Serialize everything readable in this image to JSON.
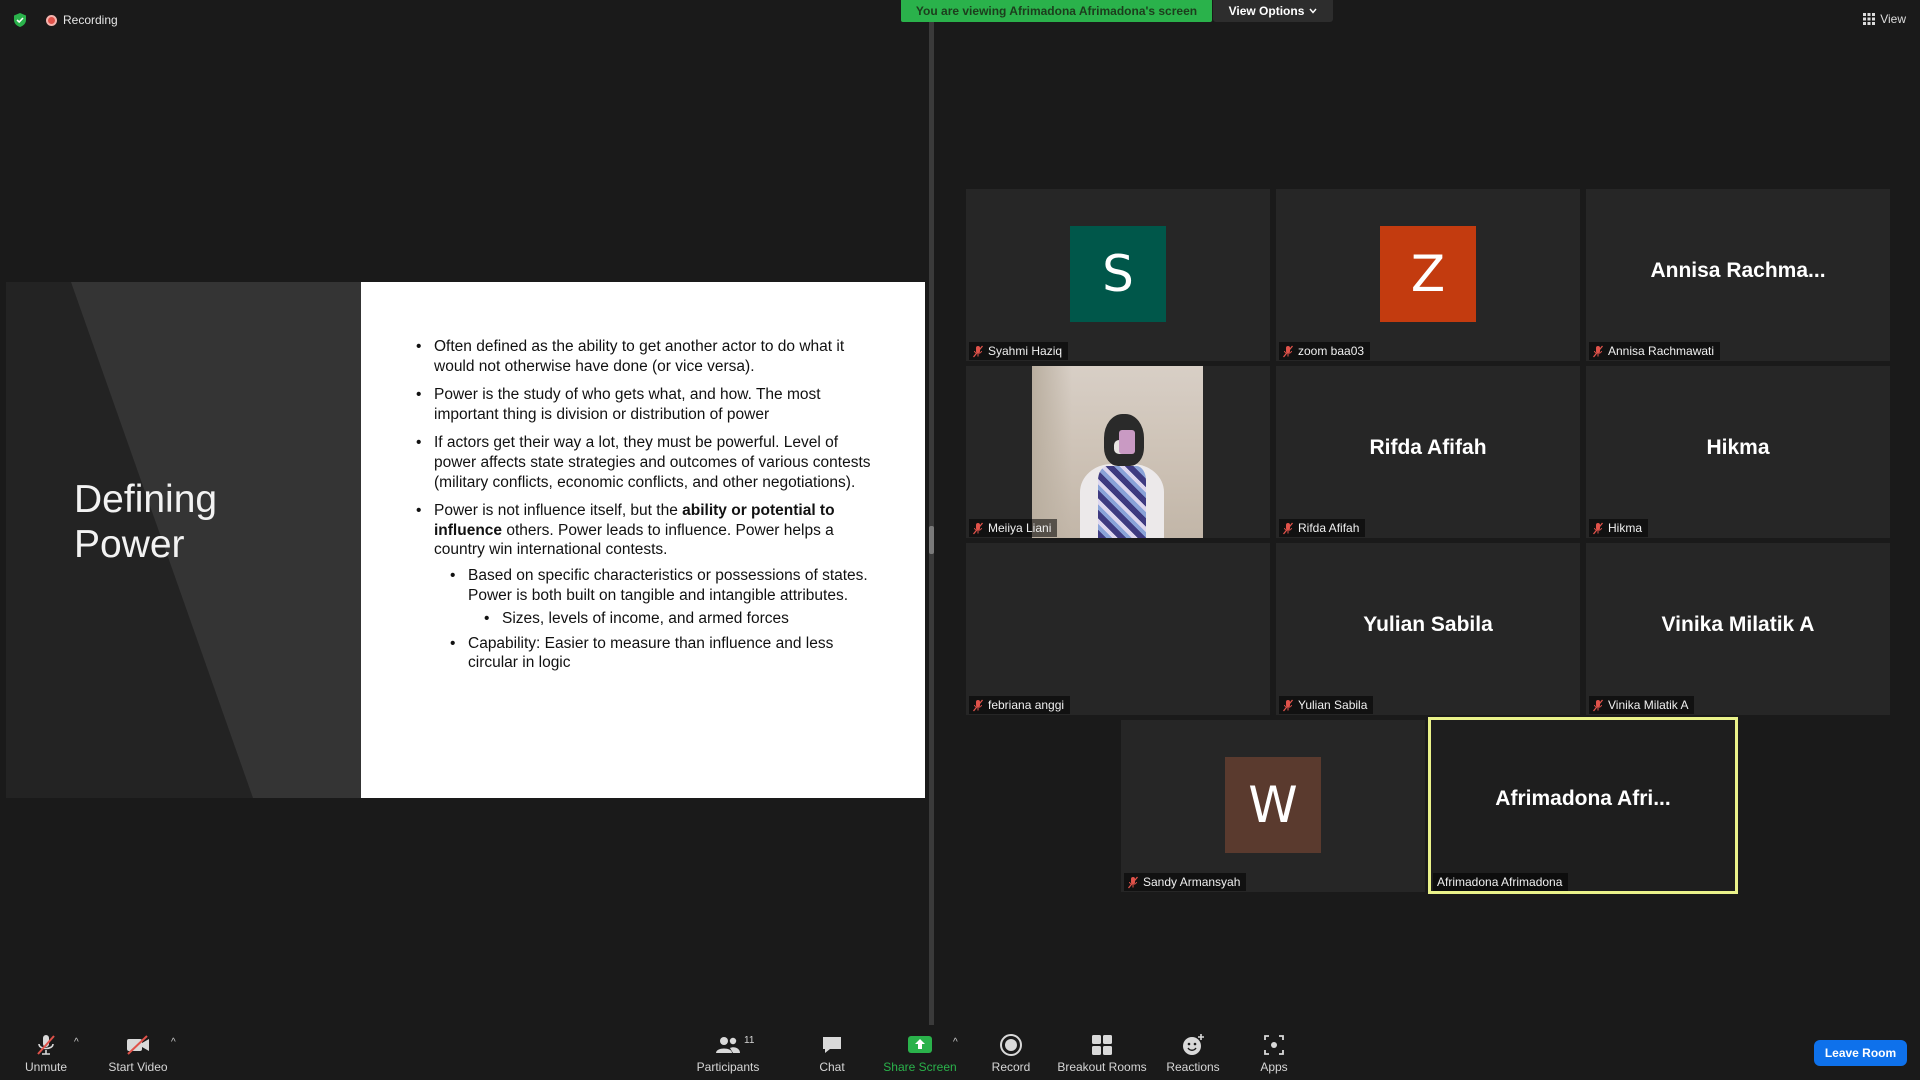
{
  "topbar": {
    "recording_label": "Recording",
    "viewing_banner": "You are viewing Afrimadona Afrimadona's screen",
    "view_options_label": "View Options",
    "view_label": "View"
  },
  "slide": {
    "title_line1": "Defining",
    "title_line2": "Power",
    "bullets": [
      "Often defined as the ability to get another actor to do what it would not otherwise have done (or vice versa).",
      "Power is the study of who gets what, and how. The most important thing is division or distribution of power",
      "If actors get their way a lot, they must be powerful. Level of power affects state strategies and outcomes of various contests (military conflicts, economic conflicts, and other negotiations)."
    ],
    "bullet4_pre": "Power is not influence itself, but the ",
    "bullet4_bold": "ability or potential to influence",
    "bullet4_post": " others. Power leads to influence. Power helps a country win international contests.",
    "sub_bullet1": "Based on specific characteristics or possessions of states. Power is both built on tangible and intangible attributes.",
    "sub_sub_bullet1": "Sizes, levels of income, and armed forces",
    "sub_bullet2": "Capability: Easier to measure than influence and less circular in logic"
  },
  "participants": [
    {
      "name": "Syahmi Haziq",
      "avatar_letter": "S",
      "avatar_color": "#00574a"
    },
    {
      "name": "zoom baa03",
      "avatar_letter": "Z",
      "avatar_color": "#c33b0f"
    },
    {
      "name": "Annisa Rachmawati",
      "display_name": "Annisa  Rachma..."
    },
    {
      "name": "Meiiya Liani"
    },
    {
      "name": "Rifda Afifah",
      "display_name": "Rifda Afifah"
    },
    {
      "name": "Hikma",
      "display_name": "Hikma"
    },
    {
      "name": "febriana anggi"
    },
    {
      "name": "Yulian Sabila",
      "display_name": "Yulian Sabila"
    },
    {
      "name": "Vinika Milatik A",
      "display_name": "Vinika Milatik A"
    },
    {
      "name": "Sandy Armansyah",
      "avatar_letter": "W",
      "avatar_color": "#5a3a2e"
    },
    {
      "name": "Afrimadona Afrimadona",
      "display_name": "Afrimadona  Afri..."
    }
  ],
  "toolbar": {
    "unmute": "Unmute",
    "start_video": "Start Video",
    "participants": "Participants",
    "participants_count": "11",
    "chat": "Chat",
    "share_screen": "Share Screen",
    "record": "Record",
    "breakout_rooms": "Breakout Rooms",
    "reactions": "Reactions",
    "apps": "Apps",
    "leave_room": "Leave Room"
  },
  "colors": {
    "share_green": "#2ab24b",
    "leave_blue": "#0e71eb",
    "active_speaker_border": "#eaf28a",
    "muted_red": "#e0524a"
  }
}
